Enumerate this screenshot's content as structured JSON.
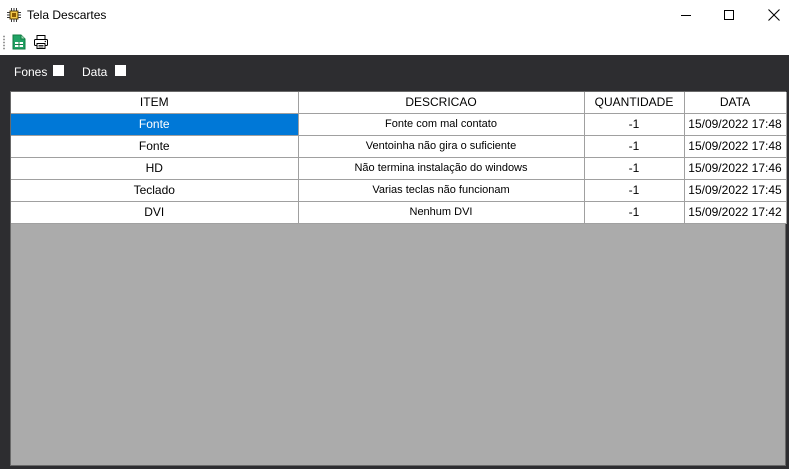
{
  "window": {
    "title": "Tela Descartes",
    "icon": "chip-icon",
    "controls": [
      "minimize-icon",
      "maximize-icon",
      "close-icon"
    ]
  },
  "toolbar": {
    "buttons": [
      {
        "icon": "excel-export-icon"
      },
      {
        "icon": "printer-icon"
      }
    ]
  },
  "filters": {
    "fones_label": "Fones",
    "fones_checked": false,
    "data_label": "Data",
    "data_checked": false
  },
  "grid": {
    "columns": [
      "ITEM",
      "DESCRICAO",
      "QUANTIDADE",
      "DATA"
    ],
    "rows": [
      {
        "item": "Fonte",
        "descricao": "Fonte com mal contato",
        "quantidade": "-1",
        "data": "15/09/2022 17:48"
      },
      {
        "item": "Fonte",
        "descricao": "Ventoinha não gira o suficiente",
        "quantidade": "-1",
        "data": "15/09/2022 17:48"
      },
      {
        "item": "HD",
        "descricao": "Não termina instalação do windows",
        "quantidade": "-1",
        "data": "15/09/2022 17:46"
      },
      {
        "item": "Teclado",
        "descricao": "Varias teclas não funcionam",
        "quantidade": "-1",
        "data": "15/09/2022 17:45"
      },
      {
        "item": "DVI",
        "descricao": "Nenhum DVI",
        "quantidade": "-1",
        "data": "15/09/2022 17:42"
      }
    ],
    "selected_cell": "rows.0.item"
  },
  "colors": {
    "selection": "#0078d7",
    "panel_background": "#2d2d30",
    "grid_empty_area": "#ababab"
  }
}
